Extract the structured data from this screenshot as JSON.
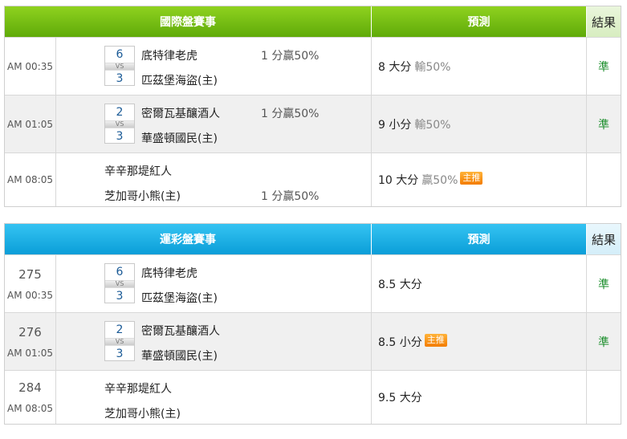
{
  "intl": {
    "header": {
      "match": "國際盤賽事",
      "prediction": "預測",
      "result": "結果"
    },
    "rows": [
      {
        "time": "AM 00:35",
        "score_home": "6",
        "score_away": "3",
        "vs": "VS",
        "team1": "底特律老虎",
        "team2": "匹茲堡海盜(主)",
        "odds": "1 分贏50%",
        "prediction": "8 大分",
        "pred_pct": "輸50%",
        "badge": "",
        "result": "準"
      },
      {
        "time": "AM 01:05",
        "score_home": "2",
        "score_away": "3",
        "vs": "VS",
        "team1": "密爾瓦基釀酒人",
        "team2": "華盛頓國民(主)",
        "odds": "1 分贏50%",
        "prediction": "9 小分",
        "pred_pct": "輸50%",
        "badge": "",
        "result": "準"
      },
      {
        "time": "AM 08:05",
        "team1": "辛辛那堤紅人",
        "team2": "芝加哥小熊(主)",
        "odds": "1 分贏50%",
        "prediction": "10 大分",
        "pred_pct": "贏50%",
        "badge": "主推",
        "result": ""
      }
    ]
  },
  "lottery": {
    "header": {
      "match": "運彩盤賽事",
      "prediction": "預測",
      "result": "結果"
    },
    "rows": [
      {
        "num": "275",
        "time": "AM 00:35",
        "score_home": "6",
        "score_away": "3",
        "vs": "VS",
        "team1": "底特律老虎",
        "team2": "匹茲堡海盜(主)",
        "prediction": "8.5 大分",
        "badge": "",
        "result": "準"
      },
      {
        "num": "276",
        "time": "AM 01:05",
        "score_home": "2",
        "score_away": "3",
        "vs": "VS",
        "team1": "密爾瓦基釀酒人",
        "team2": "華盛頓國民(主)",
        "prediction": "8.5 小分",
        "badge": "主推",
        "result": "準"
      },
      {
        "num": "284",
        "time": "AM 08:05",
        "team1": "辛辛那堤紅人",
        "team2": "芝加哥小熊(主)",
        "prediction": "9.5 大分",
        "badge": "",
        "result": ""
      }
    ]
  },
  "colors": {
    "intl_header": "#6fba0f",
    "lottery_header": "#1aaee4",
    "result_text": "#1e8f2e",
    "badge": "#f58a0c"
  }
}
